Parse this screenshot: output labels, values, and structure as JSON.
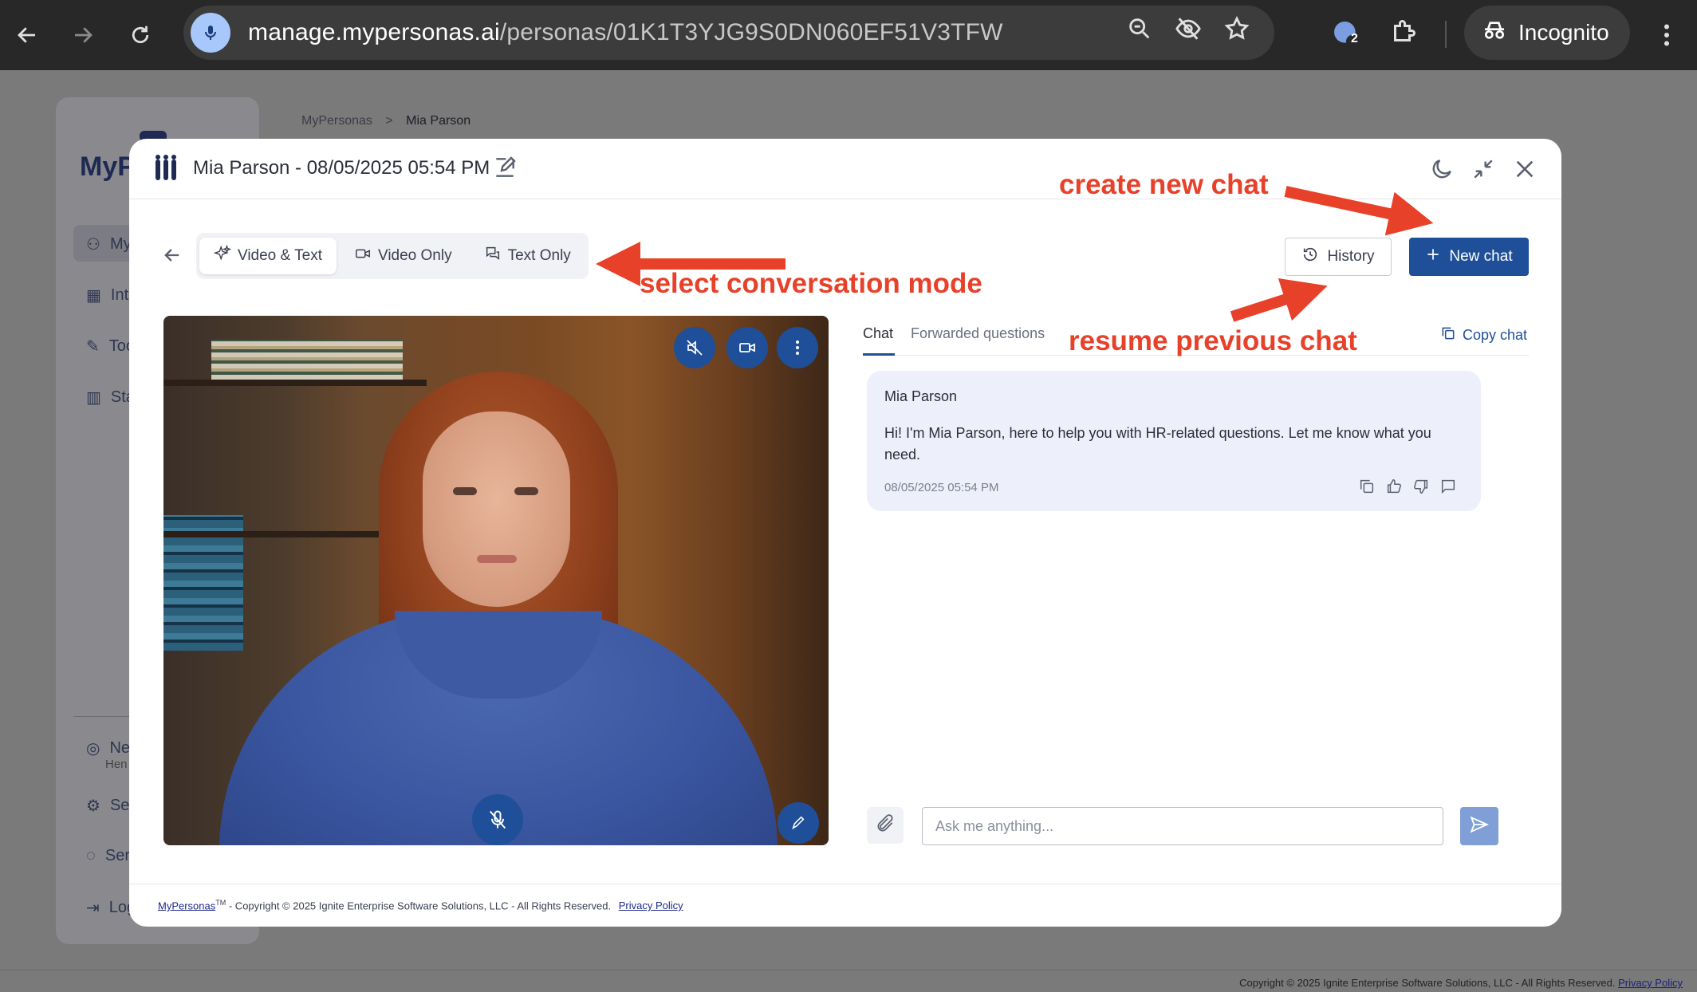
{
  "browser": {
    "url_host": "manage.mypersonas.ai",
    "url_path": "/personas/01K1T3YJG9S0DN060EF51V3TFW",
    "extension_badge": "2",
    "incognito_label": "Incognito"
  },
  "background": {
    "logo_partial": "MyP",
    "sidebar_items": [
      "My",
      "Int",
      "Too",
      "Sta"
    ],
    "sidebar_bottom": [
      "Nee",
      "Hen",
      "Set",
      "Ser",
      "Log"
    ],
    "breadcrumb_root": "MyPersonas",
    "breadcrumb_sep": ">",
    "breadcrumb_current": "Mia Parson",
    "footer_text": "Copyright © 2025 Ignite Enterprise Software Solutions, LLC - All Rights Reserved.",
    "footer_link": "Privacy Policy"
  },
  "modal": {
    "title": "Mia Parson - 08/05/2025 05:54 PM",
    "modes": [
      {
        "label": "Video & Text",
        "icon": "sparkle-icon",
        "active": true
      },
      {
        "label": "Video Only",
        "icon": "video-camera-icon",
        "active": false
      },
      {
        "label": "Text Only",
        "icon": "chat-bubbles-icon",
        "active": false
      }
    ],
    "history_label": "History",
    "new_chat_label": "New chat",
    "tabs": [
      "Chat",
      "Forwarded questions"
    ],
    "copy_chat_label": "Copy chat",
    "message": {
      "sender": "Mia Parson",
      "text": "Hi! I'm Mia Parson, here to help you with HR-related questions. Let me know what you need.",
      "time": "08/05/2025 05:54 PM"
    },
    "input_placeholder": "Ask me anything...",
    "footer": {
      "brand": "MyPersonas",
      "tm": "TM",
      "text": " - Copyright © 2025 Ignite Enterprise Software Solutions, LLC - All Rights Reserved.",
      "privacy": "Privacy Policy"
    }
  },
  "annotations": {
    "new_chat": "create new chat",
    "mode": "select conversation mode",
    "history": "resume previous chat",
    "color": "#e8412a"
  },
  "colors": {
    "primary": "#1f4f98",
    "message_bg": "#edeffb"
  }
}
